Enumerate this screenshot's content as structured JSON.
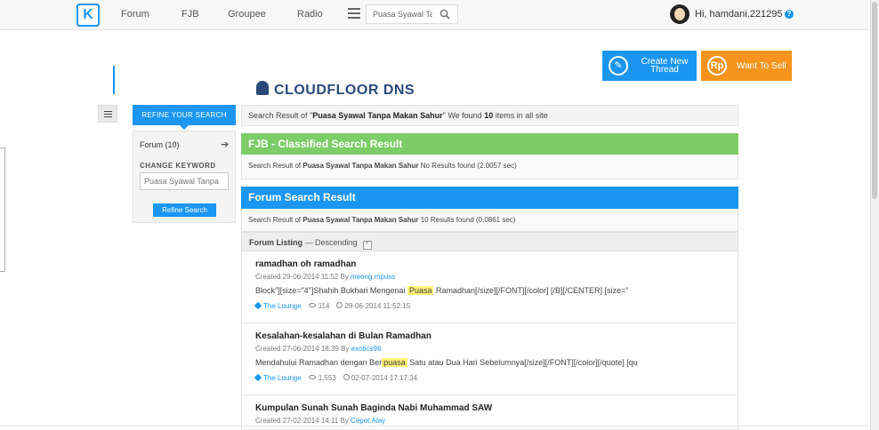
{
  "nav": {
    "logo": "K",
    "links": [
      "Forum",
      "FJB",
      "Groupee",
      "Radio"
    ],
    "search_placeholder": "Puasa Syawal Ta",
    "user_greeting": "Hi, hamdani.221295",
    "help": "?"
  },
  "actions": {
    "create_thread": "Create New Thread",
    "want_to_sell": "Want To Sell",
    "create_icon": "✎",
    "sell_icon": "Rp"
  },
  "ad": {
    "text": "CLOUDFLOOR DNS"
  },
  "sidebar": {
    "refine_tab": "REFINE YOUR SEARCH",
    "forum_filter": "Forum (10)",
    "arrow": "➔",
    "change_keyword_label": "CHANGE KEYWORD",
    "keyword_value": "Puasa Syawal Tanpa",
    "refine_button": "Refine Search"
  },
  "summary": {
    "prefix": "Search Result of \"",
    "query": "Puasa Syawal Tanpa Makan Sahur",
    "middle": "\" We found ",
    "count": "10",
    "suffix": " items in all site"
  },
  "fjb": {
    "title": "FJB - Classified Search Result",
    "prefix": "Search Result of ",
    "query": "Puasa Syawal Tanpa Makan Sahur",
    "suffix": " No Results found (2.0057 sec)"
  },
  "forum": {
    "title": "Forum Search Result",
    "prefix": "Search Result of ",
    "query": "Puasa Syawal Tanpa Makan Sahur",
    "suffix": " 10 Results found (0.0861 sec)"
  },
  "listing": {
    "label": "Forum Listing",
    "order": " — Descending",
    "toggle": "^"
  },
  "threads": [
    {
      "title": "ramadhan oh ramadhan",
      "created": "Created 29-06-2014 11:52 By ",
      "author": "meong.mpuss",
      "snippet_before": "Block\"][size=\"4\"]Shahih Bukhari Mengenai ",
      "highlight": "Puasa",
      "snippet_after": " Ramadhan[/size][/FONT][/color] [/B][/CENTER] [size=\"",
      "forum": "The Lounge",
      "views": "114",
      "last": "29-06-2014 11:52:15"
    },
    {
      "title": "Kesalahan-kesalahan di Bulan Ramadhan",
      "created": "Created 27-06-2014 18:39 By ",
      "author": "exotics96",
      "snippet_before": "Mendahului Ramadhan dengan Ber",
      "highlight": "puasa",
      "snippet_after": " Satu atau Dua Hari Sebelumnya[/size][/FONT][/color][/quote] [qu",
      "forum": "The Lounge",
      "views": "1,553",
      "last": "02-07-2014 17:17:34"
    },
    {
      "title": "Kumpulan Sunah Sunah Baginda Nabi Muhammad SAW",
      "created": "Created 27-02-2014 14:11 By ",
      "author": "Cepot.Alay"
    }
  ]
}
